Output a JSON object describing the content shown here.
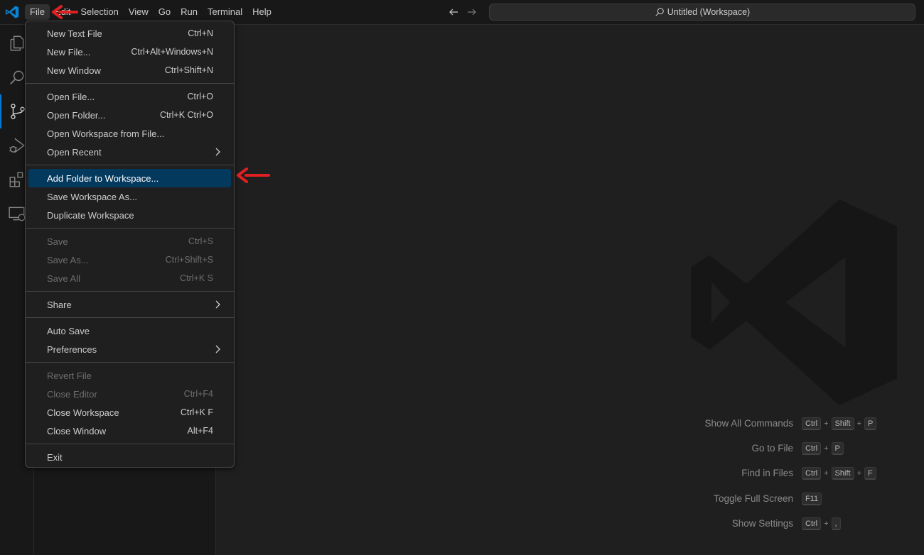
{
  "titlebar": {
    "menu": [
      "File",
      "Edit",
      "Selection",
      "View",
      "Go",
      "Run",
      "Terminal",
      "Help"
    ],
    "command_center": "Untitled (Workspace)"
  },
  "file_menu": {
    "groups": [
      [
        {
          "label": "New Text File",
          "shortcut": "Ctrl+N"
        },
        {
          "label": "New File...",
          "shortcut": "Ctrl+Alt+Windows+N"
        },
        {
          "label": "New Window",
          "shortcut": "Ctrl+Shift+N"
        }
      ],
      [
        {
          "label": "Open File...",
          "shortcut": "Ctrl+O"
        },
        {
          "label": "Open Folder...",
          "shortcut": "Ctrl+K Ctrl+O"
        },
        {
          "label": "Open Workspace from File...",
          "shortcut": ""
        },
        {
          "label": "Open Recent",
          "shortcut": "",
          "submenu": true
        }
      ],
      [
        {
          "label": "Add Folder to Workspace...",
          "shortcut": "",
          "highlighted": true
        },
        {
          "label": "Save Workspace As...",
          "shortcut": ""
        },
        {
          "label": "Duplicate Workspace",
          "shortcut": ""
        }
      ],
      [
        {
          "label": "Save",
          "shortcut": "Ctrl+S",
          "disabled": true
        },
        {
          "label": "Save As...",
          "shortcut": "Ctrl+Shift+S",
          "disabled": true
        },
        {
          "label": "Save All",
          "shortcut": "Ctrl+K S",
          "disabled": true
        }
      ],
      [
        {
          "label": "Share",
          "shortcut": "",
          "submenu": true
        }
      ],
      [
        {
          "label": "Auto Save",
          "shortcut": ""
        },
        {
          "label": "Preferences",
          "shortcut": "",
          "submenu": true
        }
      ],
      [
        {
          "label": "Revert File",
          "shortcut": "",
          "disabled": true
        },
        {
          "label": "Close Editor",
          "shortcut": "Ctrl+F4",
          "disabled": true
        },
        {
          "label": "Close Workspace",
          "shortcut": "Ctrl+K F"
        },
        {
          "label": "Close Window",
          "shortcut": "Alt+F4"
        }
      ],
      [
        {
          "label": "Exit",
          "shortcut": ""
        }
      ]
    ]
  },
  "welcome_shortcuts": [
    {
      "label": "Show All Commands",
      "keys": [
        "Ctrl",
        "Shift",
        "P"
      ]
    },
    {
      "label": "Go to File",
      "keys": [
        "Ctrl",
        "P"
      ]
    },
    {
      "label": "Find in Files",
      "keys": [
        "Ctrl",
        "Shift",
        "F"
      ]
    },
    {
      "label": "Toggle Full Screen",
      "keys": [
        "F11"
      ]
    },
    {
      "label": "Show Settings",
      "keys": [
        "Ctrl",
        ","
      ]
    }
  ],
  "activity_icons": [
    "explorer-icon",
    "search-icon",
    "source-control-icon",
    "run-debug-icon",
    "extensions-icon",
    "remote-explorer-icon"
  ],
  "colors": {
    "accent": "#0078d4",
    "highlight": "#04395e",
    "annotation_arrow": "#e02020"
  }
}
